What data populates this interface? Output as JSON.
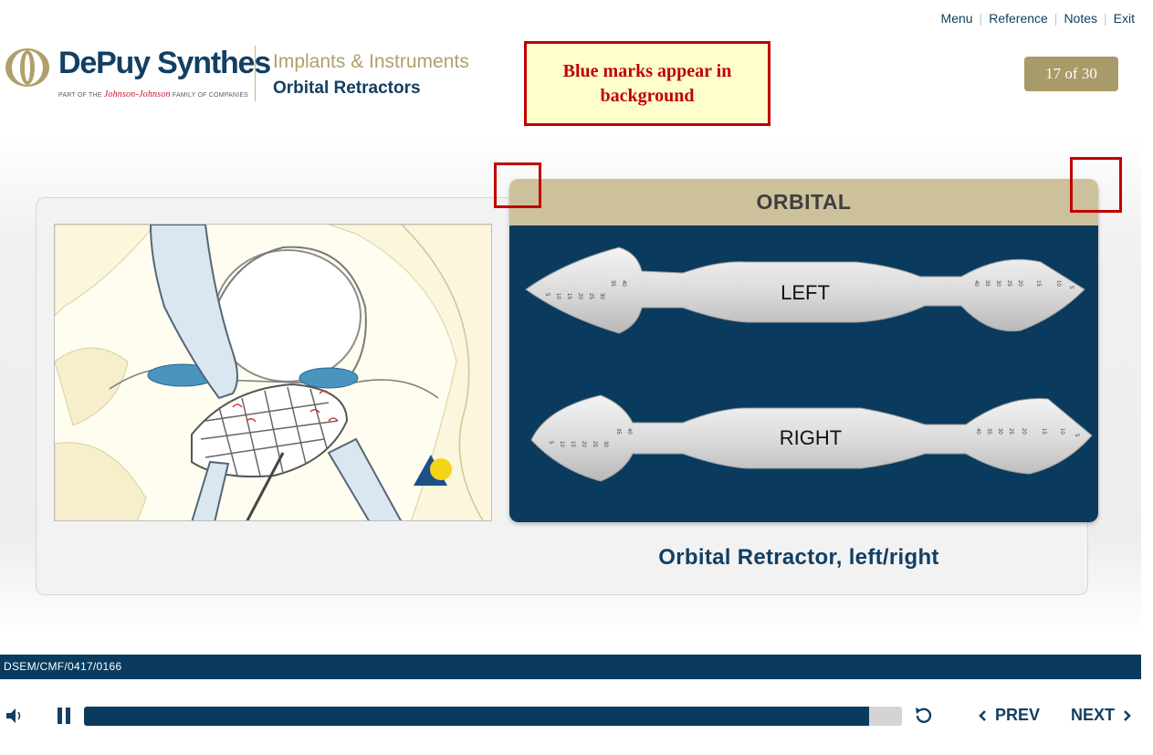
{
  "top_nav": {
    "menu": "Menu",
    "reference": "Reference",
    "notes": "Notes",
    "exit": "Exit"
  },
  "brand": {
    "name": "DePuy Synthes",
    "tagline_prefix": "PART OF THE",
    "tagline_brand": "Johnson-Johnson",
    "tagline_suffix": "FAMILY OF COMPANIES",
    "color": "#123f63",
    "accent": "#b09f6b"
  },
  "module": {
    "title": "Implants & Instruments",
    "subtitle": "Orbital Retractors"
  },
  "callout": {
    "text": "Blue marks appear in background"
  },
  "page_counter": "17 of 30",
  "content": {
    "card_header": "ORBITAL",
    "retractor_left_label": "LEFT",
    "retractor_right_label": "RIGHT",
    "scale_marks_left_end": [
      "5",
      "10",
      "15",
      "20",
      "25",
      "30",
      "35",
      "40"
    ],
    "scale_marks_right_end": [
      "40",
      "35",
      "30",
      "25",
      "20",
      "15",
      "10",
      "5"
    ],
    "caption": "Orbital Retractor, left/right"
  },
  "footer": {
    "code": "DSEM/CMF/0417/0166"
  },
  "player": {
    "progress_fraction": 0.96,
    "prev_label": "PREV",
    "next_label": "NEXT",
    "icons": [
      "speaker-icon",
      "pause-icon",
      "replay-icon",
      "chevron-left-icon",
      "chevron-right-icon"
    ]
  },
  "colors": {
    "navy": "#0a3b5e",
    "gold": "#a99a6a",
    "header_tan": "#ccc19a",
    "callout_red": "#c00000",
    "callout_bg": "#ffffcc"
  }
}
